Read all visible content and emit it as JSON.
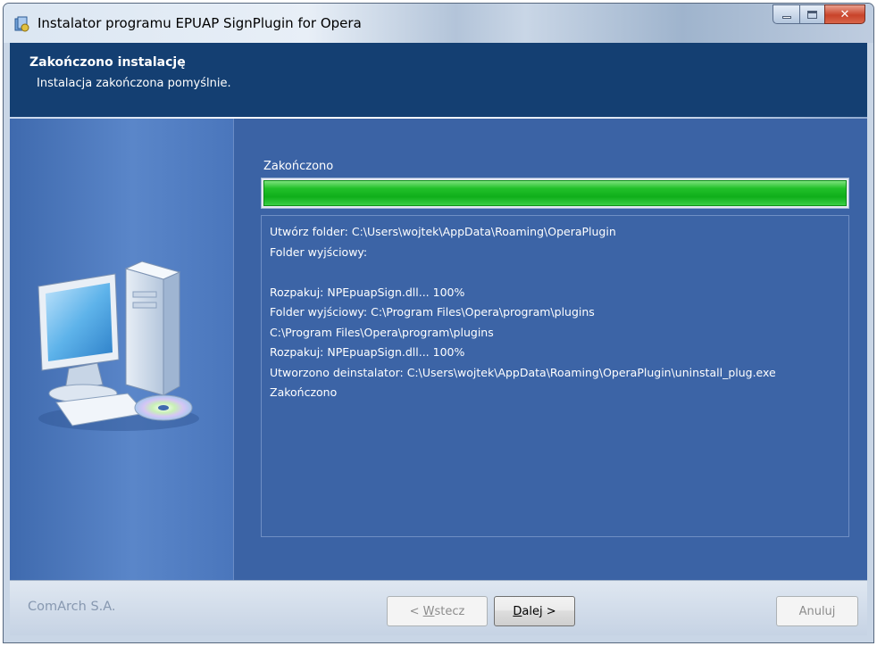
{
  "window": {
    "title": "Instalator programu EPUAP SignPlugin for Opera",
    "icon": "installer-icon"
  },
  "header": {
    "title": "Zakończono instalację",
    "subtitle": "Instalacja zakończona pomyślnie."
  },
  "progress": {
    "label": "Zakończono",
    "value": 1.0
  },
  "log": {
    "lines": [
      "Utwórz folder: C:\\Users\\wojtek\\AppData\\Roaming\\OperaPlugin",
      "Folder wyjściowy:",
      "",
      "Rozpakuj: NPEpuapSign.dll... 100%",
      "Folder wyjściowy: C:\\Program Files\\Opera\\program\\plugins",
      "C:\\Program Files\\Opera\\program\\plugins",
      "Rozpakuj: NPEpuapSign.dll... 100%",
      "Utworzono deinstalator: C:\\Users\\wojtek\\AppData\\Roaming\\OperaPlugin\\uninstall_plug.exe",
      "Zakończono"
    ]
  },
  "footer": {
    "brand": "ComArch S.A.",
    "back": {
      "prefix": "< ",
      "accel": "W",
      "rest": "stecz"
    },
    "next": {
      "accel": "D",
      "rest": "alej >"
    },
    "cancel": "Anuluj"
  },
  "colors": {
    "header_bg": "#143f72",
    "body_bg": "#3c64a6",
    "progress_fill": "#1ab825",
    "footer_bg": "#d3dde9"
  }
}
